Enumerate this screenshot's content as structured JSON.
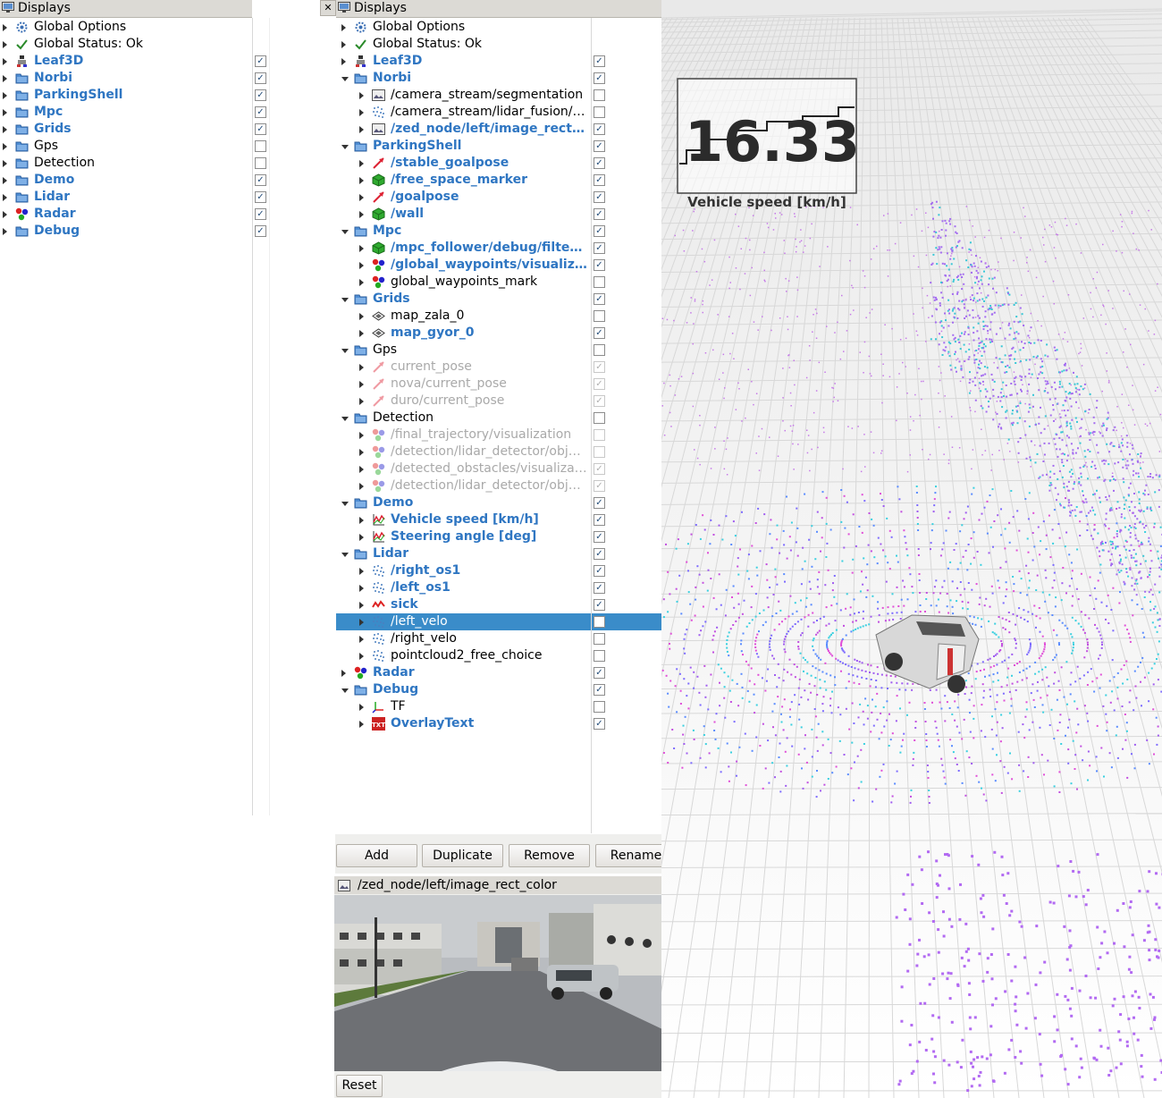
{
  "left_panel": {
    "title": "Displays",
    "rows": [
      {
        "label": "Global Options",
        "icon": "gear-icon",
        "style": "normal",
        "checkbox": null
      },
      {
        "label": "Global Status: Ok",
        "icon": "checkmark-icon",
        "style": "normal",
        "checkbox": null
      },
      {
        "label": "Leaf3D",
        "icon": "robot-model-icon",
        "style": "blue",
        "checkbox": true
      },
      {
        "label": "Norbi",
        "icon": "folder-icon",
        "style": "blue",
        "checkbox": true
      },
      {
        "label": "ParkingShell",
        "icon": "folder-icon",
        "style": "blue",
        "checkbox": true
      },
      {
        "label": "Mpc",
        "icon": "folder-icon",
        "style": "blue",
        "checkbox": true
      },
      {
        "label": "Grids",
        "icon": "folder-icon",
        "style": "blue",
        "checkbox": true
      },
      {
        "label": "Gps",
        "icon": "folder-icon",
        "style": "normal",
        "checkbox": false
      },
      {
        "label": "Detection",
        "icon": "folder-icon",
        "style": "normal",
        "checkbox": false
      },
      {
        "label": "Demo",
        "icon": "folder-icon",
        "style": "blue",
        "checkbox": true
      },
      {
        "label": "Lidar",
        "icon": "folder-icon",
        "style": "blue",
        "checkbox": true
      },
      {
        "label": "Radar",
        "icon": "marker-array-icon",
        "style": "blue",
        "checkbox": true
      },
      {
        "label": "Debug",
        "icon": "folder-icon",
        "style": "blue",
        "checkbox": true
      }
    ]
  },
  "right_panel": {
    "title": "Displays",
    "close_glyph": "✕",
    "rows": [
      {
        "label": "Global Options",
        "icon": "gear-icon",
        "style": "normal",
        "checkbox": null,
        "level": 0,
        "arrow": "closed"
      },
      {
        "label": "Global Status: Ok",
        "icon": "checkmark-icon",
        "style": "normal",
        "checkbox": null,
        "level": 0,
        "arrow": "closed"
      },
      {
        "label": "Leaf3D",
        "icon": "robot-model-icon",
        "style": "blue",
        "checkbox": true,
        "level": 0,
        "arrow": "closed"
      },
      {
        "label": "Norbi",
        "icon": "folder-icon",
        "style": "blue",
        "checkbox": true,
        "level": 0,
        "arrow": "open"
      },
      {
        "label": "/camera_stream/segmentation",
        "icon": "image-icon",
        "style": "normal",
        "checkbox": false,
        "level": 1,
        "arrow": "closed"
      },
      {
        "label": "/camera_stream/lidar_fusion/…",
        "icon": "pointcloud-icon",
        "style": "normal",
        "checkbox": false,
        "level": 1,
        "arrow": "closed"
      },
      {
        "label": "/zed_node/left/image_rect_…",
        "icon": "image-icon",
        "style": "blue",
        "checkbox": true,
        "level": 1,
        "arrow": "closed"
      },
      {
        "label": "ParkingShell",
        "icon": "folder-icon",
        "style": "blue",
        "checkbox": true,
        "level": 0,
        "arrow": "open"
      },
      {
        "label": "/stable_goalpose",
        "icon": "pose-arrow-icon",
        "style": "blue",
        "checkbox": true,
        "level": 1,
        "arrow": "closed"
      },
      {
        "label": "/free_space_marker",
        "icon": "marker-cube-icon",
        "style": "blue",
        "checkbox": true,
        "level": 1,
        "arrow": "closed"
      },
      {
        "label": "/goalpose",
        "icon": "pose-arrow-icon",
        "style": "blue",
        "checkbox": true,
        "level": 1,
        "arrow": "closed"
      },
      {
        "label": "/wall",
        "icon": "marker-cube-icon",
        "style": "blue",
        "checkbox": true,
        "level": 1,
        "arrow": "closed"
      },
      {
        "label": "Mpc",
        "icon": "folder-icon",
        "style": "blue",
        "checkbox": true,
        "level": 0,
        "arrow": "open"
      },
      {
        "label": "/mpc_follower/debug/filter…",
        "icon": "marker-cube-icon",
        "style": "blue",
        "checkbox": true,
        "level": 1,
        "arrow": "closed"
      },
      {
        "label": "/global_waypoints/visualiza…",
        "icon": "marker-array-icon",
        "style": "blue",
        "checkbox": true,
        "level": 1,
        "arrow": "closed"
      },
      {
        "label": "global_waypoints_mark",
        "icon": "marker-array-icon",
        "style": "normal",
        "checkbox": false,
        "level": 1,
        "arrow": "closed"
      },
      {
        "label": "Grids",
        "icon": "folder-icon",
        "style": "blue",
        "checkbox": true,
        "level": 0,
        "arrow": "open"
      },
      {
        "label": "map_zala_0",
        "icon": "map-icon",
        "style": "normal",
        "checkbox": false,
        "level": 1,
        "arrow": "closed"
      },
      {
        "label": "map_gyor_0",
        "icon": "map-icon",
        "style": "blue",
        "checkbox": true,
        "level": 1,
        "arrow": "closed"
      },
      {
        "label": "Gps",
        "icon": "folder-icon",
        "style": "normal",
        "checkbox": false,
        "level": 0,
        "arrow": "open"
      },
      {
        "label": "current_pose",
        "icon": "pose-arrow-icon",
        "style": "disabled",
        "checkbox": true,
        "level": 1,
        "arrow": "closed"
      },
      {
        "label": "nova/current_pose",
        "icon": "pose-arrow-icon",
        "style": "disabled",
        "checkbox": true,
        "level": 1,
        "arrow": "closed"
      },
      {
        "label": "duro/current_pose",
        "icon": "pose-arrow-icon",
        "style": "disabled",
        "checkbox": true,
        "level": 1,
        "arrow": "closed"
      },
      {
        "label": "Detection",
        "icon": "folder-icon",
        "style": "normal",
        "checkbox": false,
        "level": 0,
        "arrow": "open"
      },
      {
        "label": "/final_trajectory/visualization",
        "icon": "marker-array-icon",
        "style": "disabled",
        "checkbox": false,
        "level": 1,
        "arrow": "closed"
      },
      {
        "label": "/detection/lidar_detector/obj…",
        "icon": "marker-array-icon",
        "style": "disabled",
        "checkbox": false,
        "level": 1,
        "arrow": "closed"
      },
      {
        "label": "/detected_obstacles/visualiza…",
        "icon": "marker-array-icon",
        "style": "disabled",
        "checkbox": true,
        "level": 1,
        "arrow": "closed"
      },
      {
        "label": "/detection/lidar_detector/obj…",
        "icon": "marker-array-icon",
        "style": "disabled",
        "checkbox": true,
        "level": 1,
        "arrow": "closed"
      },
      {
        "label": "Demo",
        "icon": "folder-icon",
        "style": "blue",
        "checkbox": true,
        "level": 0,
        "arrow": "open"
      },
      {
        "label": "Vehicle speed [km/h]",
        "icon": "plot-icon",
        "style": "blue",
        "checkbox": true,
        "level": 1,
        "arrow": "closed"
      },
      {
        "label": "Steering angle [deg]",
        "icon": "plot-icon",
        "style": "blue",
        "checkbox": true,
        "level": 1,
        "arrow": "closed"
      },
      {
        "label": "Lidar",
        "icon": "folder-icon",
        "style": "blue",
        "checkbox": true,
        "level": 0,
        "arrow": "open"
      },
      {
        "label": "/right_os1",
        "icon": "pointcloud-icon",
        "style": "blue",
        "checkbox": true,
        "level": 1,
        "arrow": "closed"
      },
      {
        "label": "/left_os1",
        "icon": "pointcloud-icon",
        "style": "blue",
        "checkbox": true,
        "level": 1,
        "arrow": "closed"
      },
      {
        "label": "sick",
        "icon": "laserscan-icon",
        "style": "blue",
        "checkbox": true,
        "level": 1,
        "arrow": "closed"
      },
      {
        "label": "/left_velo",
        "icon": "pointcloud-icon",
        "style": "normal",
        "checkbox": false,
        "level": 1,
        "arrow": "closed",
        "selected": true
      },
      {
        "label": "/right_velo",
        "icon": "pointcloud-icon",
        "style": "normal",
        "checkbox": false,
        "level": 1,
        "arrow": "closed"
      },
      {
        "label": "pointcloud2_free_choice",
        "icon": "pointcloud-icon",
        "style": "normal",
        "checkbox": false,
        "level": 1,
        "arrow": "closed"
      },
      {
        "label": "Radar",
        "icon": "marker-array-icon",
        "style": "blue",
        "checkbox": true,
        "level": 0,
        "arrow": "closed"
      },
      {
        "label": "Debug",
        "icon": "folder-icon",
        "style": "blue",
        "checkbox": true,
        "level": 0,
        "arrow": "open"
      },
      {
        "label": "TF",
        "icon": "tf-axes-icon",
        "style": "normal",
        "checkbox": false,
        "level": 1,
        "arrow": "closed"
      },
      {
        "label": "OverlayText",
        "icon": "overlay-text-icon",
        "style": "blue",
        "checkbox": true,
        "level": 1,
        "arrow": "closed"
      }
    ]
  },
  "buttons": {
    "add": "Add",
    "duplicate": "Duplicate",
    "remove": "Remove",
    "rename": "Rename"
  },
  "image_panel": {
    "title": "/zed_node/left/image_rect_color",
    "reset": "Reset"
  },
  "overlay": {
    "speed_value": "16.33",
    "speed_label": "Vehicle speed [km/h]"
  },
  "colors": {
    "accent_blue": "#2f76c2",
    "selection": "#3a8cc9",
    "folder": "#4f8ed4"
  }
}
